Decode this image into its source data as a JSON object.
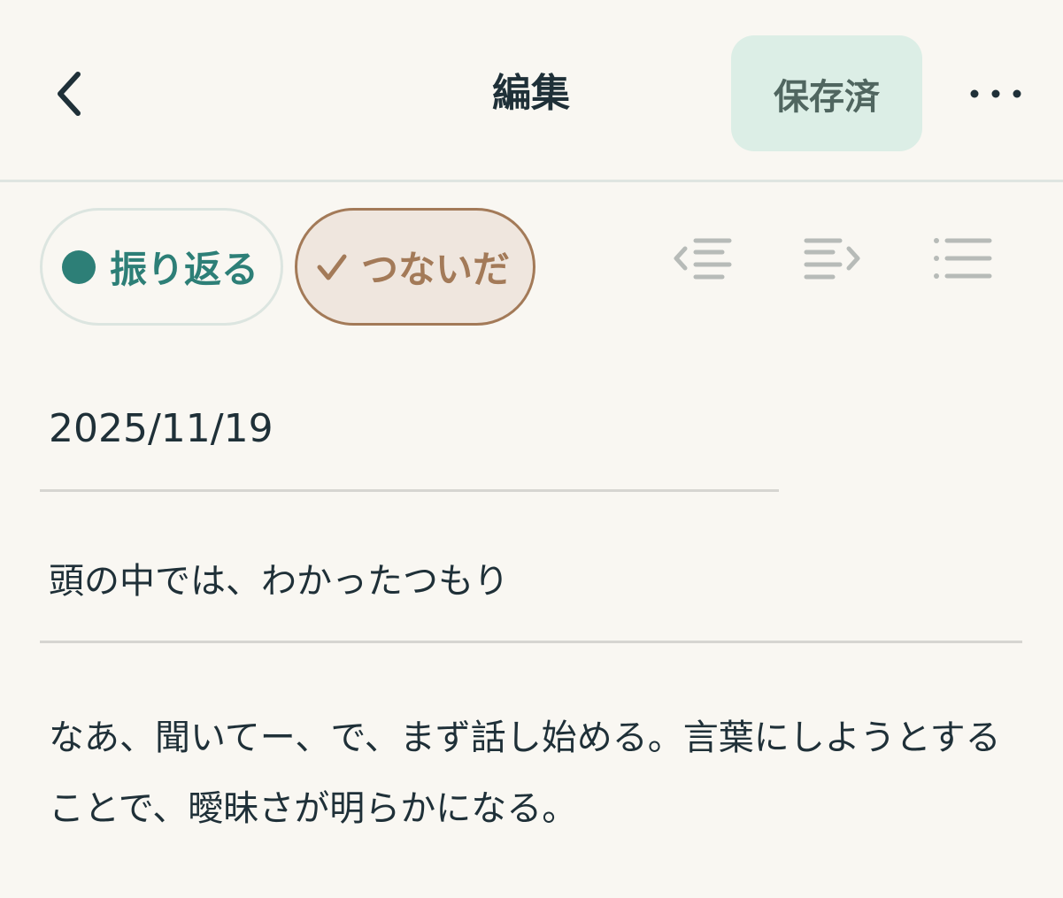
{
  "header": {
    "back_icon": "chevron-left-icon",
    "title": "編集",
    "saved_label": "保存済",
    "more_icon": "more-horizontal-icon"
  },
  "mode_chips": [
    {
      "label": "振り返る",
      "icon": "filled-dot-icon",
      "selected": false,
      "color": "#2d7f77"
    },
    {
      "label": "つないだ",
      "icon": "check-icon",
      "selected": true,
      "color": "#a37a58"
    }
  ],
  "toolbar": {
    "items": [
      {
        "icon": "outdent-icon"
      },
      {
        "icon": "indent-icon"
      },
      {
        "icon": "bulleted-list-icon"
      }
    ]
  },
  "entry": {
    "date": "2025/11/19",
    "title": "頭の中では、わかったつもり",
    "body": "なあ、聞いてー、で、まず話し始める。言葉にしようとすることで、曖昧さが明らかになる。"
  },
  "colors": {
    "background": "#f9f7f2",
    "accent_teal": "#2d7f77",
    "accent_brown": "#a37a58",
    "saved_bg": "#dceee6"
  }
}
